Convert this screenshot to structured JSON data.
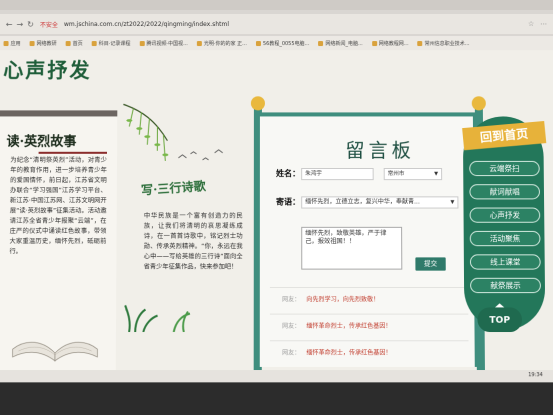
{
  "browser": {
    "security": "不安全",
    "url": "wm.jschina.com.cn/zt2022/2022/qingming/index.shtml",
    "bookmarks": [
      "应用",
      "网络教研",
      "首页",
      "科目·记录课程",
      "腾讯视频·中国视...",
      "光明·你的的家 正...",
      "56教程_0055电脑...",
      "网络新闻_电脑...",
      "网络教程网...",
      "常州信息职业技术..."
    ]
  },
  "page": {
    "site_title": "心声抒发",
    "story": {
      "title": "读·英烈故事",
      "text": "为纪念“清明祭英烈”活动，对青少年的教育作用，进一步培养青少年的爱国情怀，前日起，江苏省文明办联合“学习强国”江苏学习平台、新江苏·中国江苏网、江苏文明网开展“读·英烈故事”征集活动。活动邀请江苏全省青少年报聚“云端”，在庄严的仪式中诵读红色故事，带领大家重温历史，缅怀先烈，砥砺前行。"
    },
    "poem": {
      "title": "写·三行诗歌",
      "text": "中华民族是一个富有创造力的民族，让我们将清明的哀思凝练成诗，在一首首诗歌中，铭记烈士功勋、传承英烈精神。“你，永远在我心中——写给英雄的三行诗”面向全省青少年征集作品，快来参加吧！"
    }
  },
  "board": {
    "title": "留言板",
    "name_label": "姓名：",
    "name_value": "朱鸿宇",
    "city_value": "常州市",
    "motto_label": "寄语：",
    "motto_value": "缅怀先烈，立德立志，复兴中华，奉献青...",
    "message_value": "缅怀先烈，致敬英雄，严于律己，报效祖国！！",
    "submit_label": "提交",
    "comments": [
      {
        "who": "网友：",
        "text": "向先烈学习，向先烈致敬！"
      },
      {
        "who": "网友：",
        "text": "缅怀革命烈士，传承红色基因！"
      },
      {
        "who": "网友：",
        "text": "缅怀革命烈士，传承红色基因！"
      }
    ]
  },
  "nav": {
    "home": "回到首页",
    "items": [
      "云端祭扫",
      "献词献唱",
      "心声抒发",
      "活动聚焦",
      "线上课堂",
      "献祭展示"
    ],
    "top": "TOP"
  },
  "taskbar": {
    "clock": "19:34"
  },
  "colors": {
    "green": "#23775a",
    "gold": "#e7b23a",
    "teal": "#3f8e7e",
    "red_text": "#c03a2b"
  }
}
